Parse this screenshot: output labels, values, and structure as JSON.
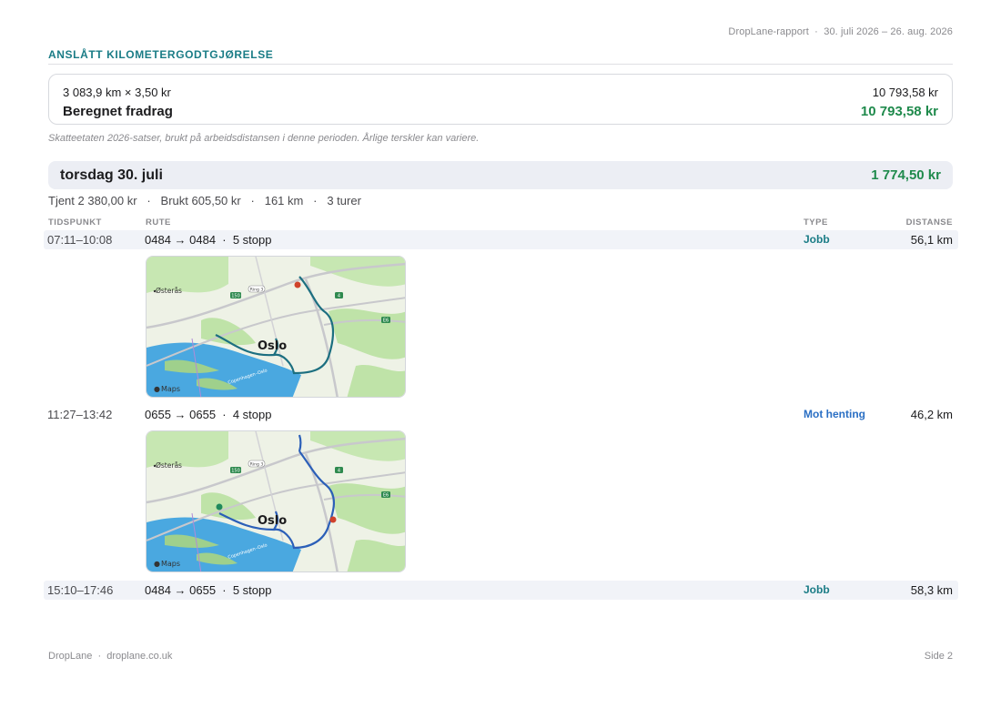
{
  "header": {
    "report_label": "DropLane-rapport",
    "separator": "·",
    "period": "30. juli 2026 – 26. aug. 2026"
  },
  "mileage": {
    "section_title": "ANSLÅTT KILOMETERGODTGJØRELSE",
    "calc_formula": "3 083,9 km × 3,50 kr",
    "calc_amount": "10 793,58 kr",
    "deduction_label": "Beregnet fradrag",
    "deduction_amount": "10 793,58 kr",
    "note": "Skatteetaten 2026-satser, brukt på arbeidsdistansen i denne perioden. Årlige terskler kan variere."
  },
  "day": {
    "title": "torsdag 30. juli",
    "total": "1 774,50 kr",
    "stats": "Tjent 2 380,00 kr   ·   Brukt 605,50 kr   ·   161 km   ·   3 turer"
  },
  "columns": {
    "time": "TIDSPUNKT",
    "route": "RUTE",
    "type": "TYPE",
    "distance": "DISTANSE"
  },
  "trips": [
    {
      "time": "07:11–10:08",
      "route": "0484 → 0484  ·  5 stopp",
      "type": "Jobb",
      "distance": "56,1 km"
    },
    {
      "time": "11:27–13:42",
      "route": "0655 → 0655  ·  4 stopp",
      "type": "Mot henting",
      "distance": "46,2 km"
    },
    {
      "time": "15:10–17:46",
      "route": "0484 → 0655  ·  5 stopp",
      "type": "Jobb",
      "distance": "58,3 km"
    }
  ],
  "map": {
    "city_label": "Oslo",
    "place_label": "Østerås",
    "attribution": "Maps",
    "water_label": "Copenhagen–Oslo",
    "road_labels": [
      "150",
      "Ring 3",
      "4",
      "E6"
    ]
  },
  "colors": {
    "accent_teal": "#1a7c86",
    "accent_green": "#1f8a4c",
    "accent_blue": "#2a6fc4",
    "route_job": "#1c6f80",
    "route_pickup": "#2b5fb8",
    "map_land": "#eef2e6",
    "map_water": "#4aa8e0",
    "map_park": "#bfe3a8"
  },
  "footer": {
    "brand": "DropLane",
    "separator": "·",
    "site": "droplane.co.uk",
    "page": "Side 2"
  }
}
